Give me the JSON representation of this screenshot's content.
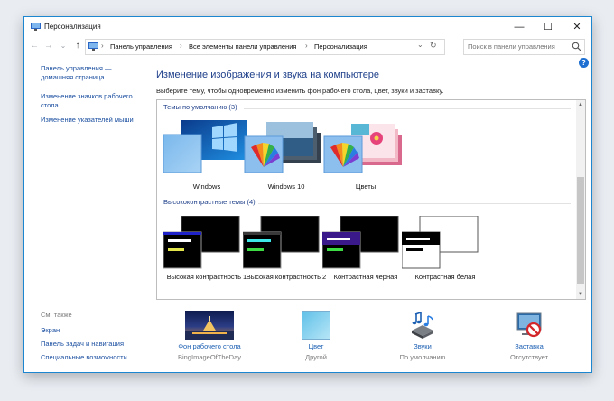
{
  "window": {
    "title": "Персонализация",
    "controls": {
      "minimize": "—",
      "maximize": "☐",
      "close": "✕"
    }
  },
  "address": {
    "crumbs": [
      "Панель управления",
      "Все элементы панели управления",
      "Персонализация"
    ],
    "search_placeholder": "Поиск в панели управления"
  },
  "sidebar": {
    "links": [
      "Панель управления — домашняя страница",
      "Изменение значков рабочего стола",
      "Изменение указателей мыши"
    ],
    "see_also_title": "См. также",
    "see_also": [
      "Экран",
      "Панель задач и навигация",
      "Специальные возможности"
    ]
  },
  "main": {
    "heading": "Изменение изображения и звука на компьютере",
    "description": "Выберите тему, чтобы одновременно изменить фон рабочего стола, цвет, звуки и заставку."
  },
  "themes": {
    "default_group": "Темы по умолчанию (3)",
    "default": [
      "Windows",
      "Windows 10",
      "Цветы"
    ],
    "contrast_group": "Высококонтрастные темы (4)",
    "contrast": [
      "Высокая контрастность 1",
      "Высокая контрастность 2",
      "Контрастная черная",
      "Контрастная белая"
    ]
  },
  "bottom": {
    "wallpaper": {
      "label": "Фон рабочего стола",
      "value": "BingImageOfTheDay"
    },
    "color": {
      "label": "Цвет",
      "value": "Другой"
    },
    "sounds": {
      "label": "Звуки",
      "value": "По умолчанию"
    },
    "screensaver": {
      "label": "Заставка",
      "value": "Отсутствует"
    }
  },
  "colors": {
    "accent": "#1d86d0",
    "link": "#1b4fa0",
    "heading": "#1e3f8a"
  }
}
